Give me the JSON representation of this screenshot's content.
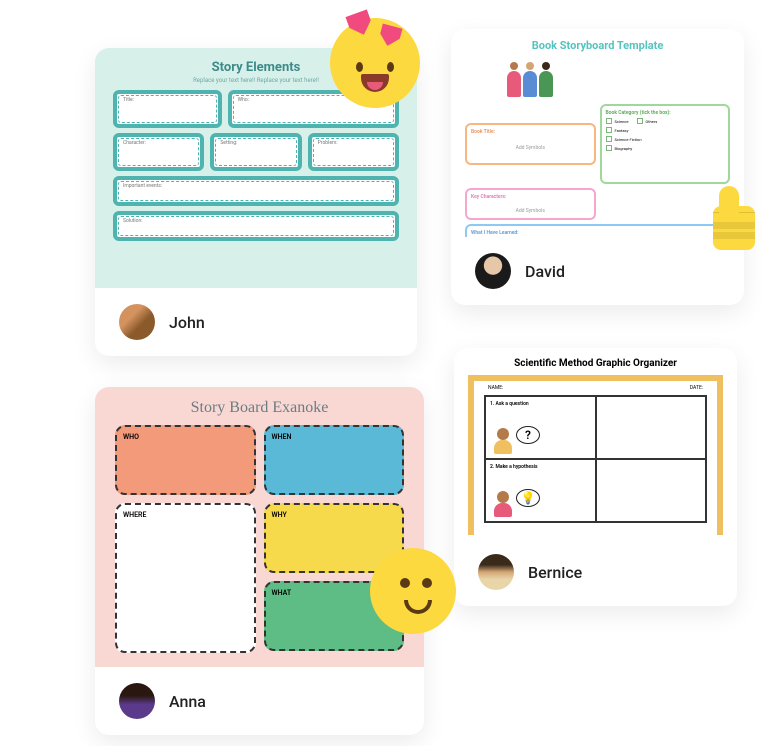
{
  "cards": {
    "john": {
      "author": "John",
      "template": {
        "title": "Story Elements",
        "subtitle": "Replace your text here!! Replace your text here!!",
        "boxes": {
          "r1a": "Title:",
          "r1b": "Who:",
          "r2a": "Character:",
          "r2b": "Setting:",
          "r2c": "Problem:",
          "r3": "Important events:",
          "r4": "Solution:"
        }
      }
    },
    "david": {
      "author": "David",
      "template": {
        "title": "Book Storyboard Template",
        "book_title_label": "Book Title:",
        "actors_label": "Key Characters:",
        "category_label": "Book Category (tick the box):",
        "categories": [
          "Science",
          "Others",
          "Fantasy",
          "Science Fiction",
          "Biography"
        ],
        "learned_label": "What I Have Learned:",
        "placeholder": "Add Symbols"
      }
    },
    "anna": {
      "author": "Anna",
      "template": {
        "title": "Story Board Exanoke",
        "who": "WHO",
        "when": "WHEN",
        "where": "WHERE",
        "why": "WHY",
        "what": "WHAT"
      }
    },
    "bernice": {
      "author": "Bernice",
      "template": {
        "title": "Scientific Method Graphic Organizer",
        "name_label": "NAME:",
        "date_label": "DATE:",
        "step1": "1. Ask a question",
        "step2": "2. Make a hypothesis"
      }
    }
  },
  "emojis": {
    "heart_eyes": "heart-eyes-emoji",
    "thumbs_up": "thumbs-up-emoji",
    "smile": "smiley-emoji"
  }
}
